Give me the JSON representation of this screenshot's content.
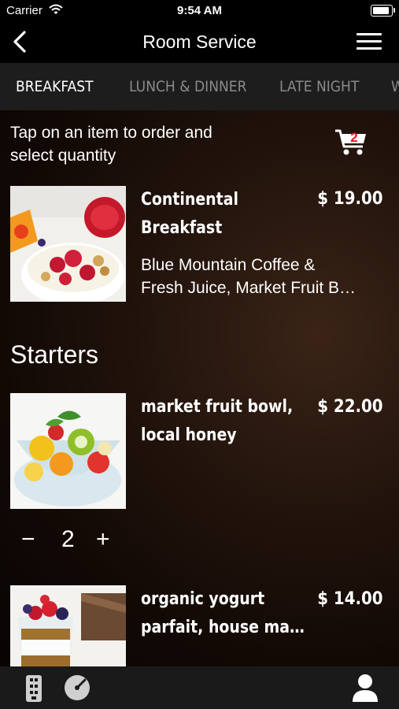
{
  "status_bar": {
    "carrier": "Carrier",
    "time": "9:54 AM",
    "battery_level": 0.9
  },
  "nav": {
    "title": "Room Service"
  },
  "tabs": [
    {
      "label": "BREAKFAST",
      "active": true
    },
    {
      "label": "LUNCH & DINNER",
      "active": false
    },
    {
      "label": "LATE NIGHT",
      "active": false
    },
    {
      "label": "W",
      "active": false
    }
  ],
  "instructions": {
    "line1": "Tap on an item to order and",
    "line2": "select quantity"
  },
  "cart": {
    "count": "2"
  },
  "items": [
    {
      "name_line1": "Continental",
      "name_line2": "Breakfast",
      "price": "$ 19.00",
      "desc_line1": "Blue Mountain Coffee &",
      "desc_line2": "Fresh Juice, Market Fruit B…"
    },
    {
      "name_line1": "market fruit bowl,",
      "name_line2": "local honey",
      "price": "$ 22.00",
      "quantity": "2",
      "minus": "−",
      "plus": "+"
    },
    {
      "name_line1": "organic yogurt",
      "name_line2": "parfait, house ma…",
      "price": "$ 14.00"
    }
  ],
  "section": {
    "title": "Starters"
  },
  "colors": {
    "accent_red": "#e21b23",
    "tab_inactive": "#8a8a8a",
    "tab_bar": "#1d1d1d"
  }
}
